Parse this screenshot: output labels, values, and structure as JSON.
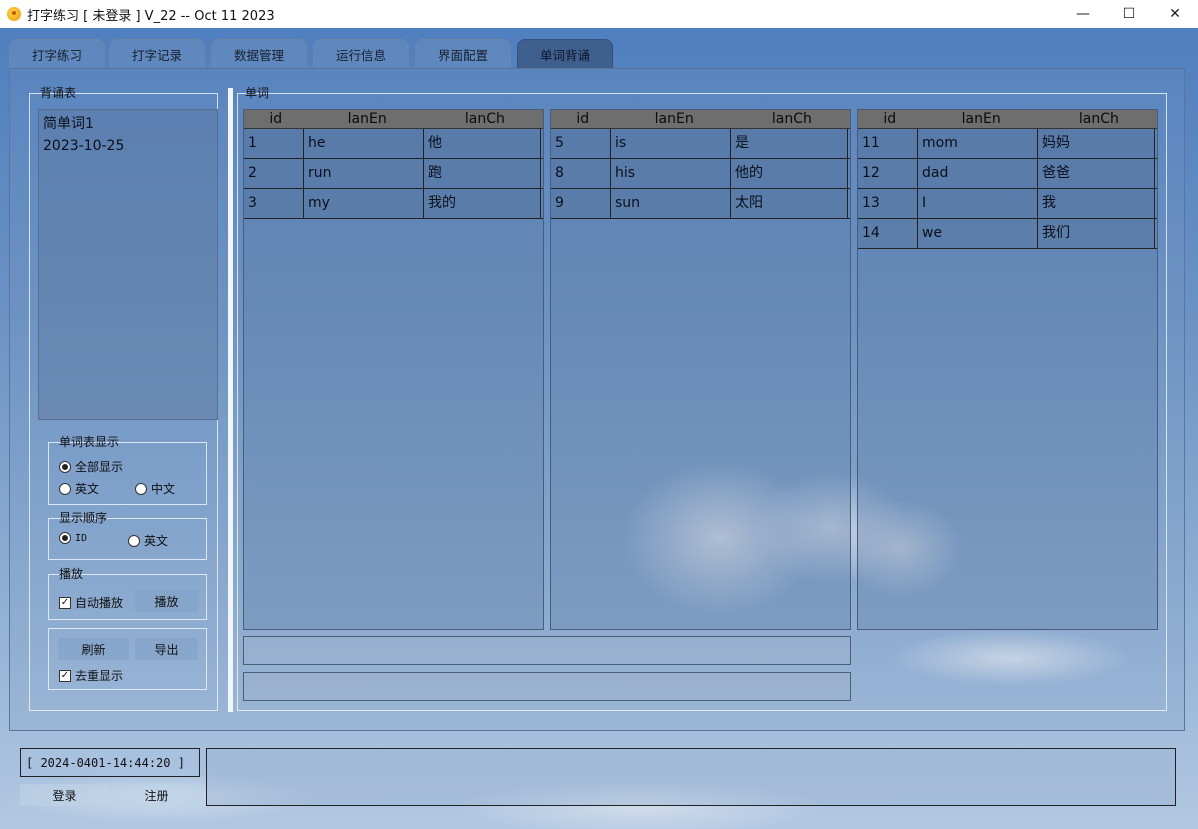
{
  "window": {
    "title": "打字练习 [ 未登录 ] V_22 -- Oct 11 2023",
    "minimize": "—",
    "maximize": "☐",
    "close": "✕"
  },
  "tabs": [
    {
      "label": "打字练习"
    },
    {
      "label": "打字记录"
    },
    {
      "label": "数据管理"
    },
    {
      "label": "运行信息"
    },
    {
      "label": "界面配置"
    },
    {
      "label": "单词背诵",
      "active": true
    }
  ],
  "left": {
    "group_title": "背诵表",
    "list_items": [
      "简单词1",
      "2023-10-25"
    ],
    "display": {
      "title": "单词表显示",
      "all": "全部显示",
      "english": "英文",
      "chinese": "中文",
      "selected": "全部显示"
    },
    "order": {
      "title": "显示顺序",
      "id": "ID",
      "english": "英文",
      "selected": "ID"
    },
    "play": {
      "title": "播放",
      "auto_label": "自动播放",
      "auto_checked": true,
      "play_button": "播放"
    },
    "actions": {
      "refresh": "刷新",
      "export": "导出",
      "dedupe_label": "去重显示",
      "dedupe_checked": true
    }
  },
  "words": {
    "group_title": "单词",
    "columns": [
      "id",
      "lanEn",
      "lanCh"
    ],
    "tables": [
      [
        [
          "1",
          "he",
          "他"
        ],
        [
          "2",
          "run",
          "跑"
        ],
        [
          "3",
          "my",
          "我的"
        ]
      ],
      [
        [
          "5",
          "is",
          "是"
        ],
        [
          "8",
          "his",
          "他的"
        ],
        [
          "9",
          "sun",
          "太阳"
        ]
      ],
      [
        [
          "11",
          "mom",
          "妈妈"
        ],
        [
          "12",
          "dad",
          "爸爸"
        ],
        [
          "13",
          "I",
          "我"
        ],
        [
          "14",
          "we",
          "我们"
        ]
      ]
    ]
  },
  "footer": {
    "time": "[ 2024-0401-14:44:20 ]",
    "login": "登录",
    "register": "注册"
  },
  "colors": {
    "sky_top": "#4f7fbf",
    "sky_bottom": "#b2c8e2",
    "active_tab": "#3f5f8f",
    "table_header": "#6e6e6e"
  }
}
